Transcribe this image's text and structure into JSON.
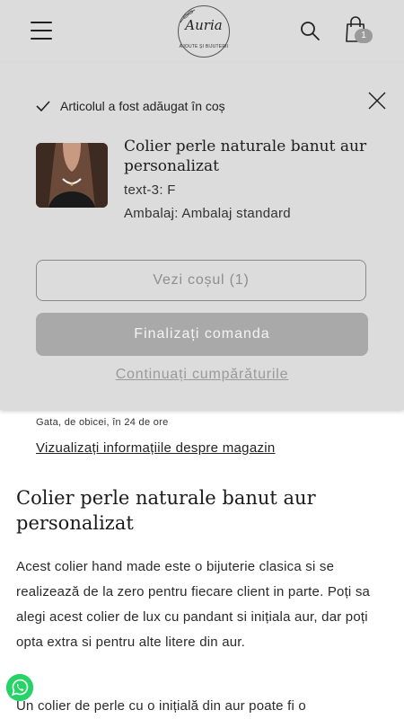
{
  "header": {
    "logo_text": "Auria",
    "logo_tagline": "AJOUTE ŞI BIJUTERII",
    "cart_count": "1"
  },
  "cart_notice": {
    "message": "Articolul a fost adăugat în coș",
    "product_name": "Colier perle naturale banut aur personalizat",
    "option_1": "text-3: F",
    "option_2": "Ambalaj: Ambalaj standard",
    "view_cart_label": "Vezi coșul (1)",
    "checkout_label": "Finalizați comanda",
    "continue_label": "Continuați cumpărăturile"
  },
  "page": {
    "ready_text": "Gata, de obicei, în 24 de ore",
    "store_link": "Vizualizați informațiile despre magazin",
    "title": "Colier perle naturale banut aur personalizat",
    "description": "Acest colier hand made este o bijuterie clasica si se realizează de la zero pentru fiecare client in parte. Poți sa alegi acest colier de lux cu pandant si inițiala aur, dar poți opta extra si pentru alte litere din aur.",
    "description_2": "Un colier de perle cu o inițială din aur poate fi o"
  },
  "colors": {
    "overlay_bg": "#dcdcdc",
    "checkout_bg": "#a9a9a9",
    "whatsapp_green": "#25d366"
  },
  "icons": [
    "menu-icon",
    "search-icon",
    "cart-icon",
    "check-icon",
    "close-icon",
    "whatsapp-icon"
  ]
}
